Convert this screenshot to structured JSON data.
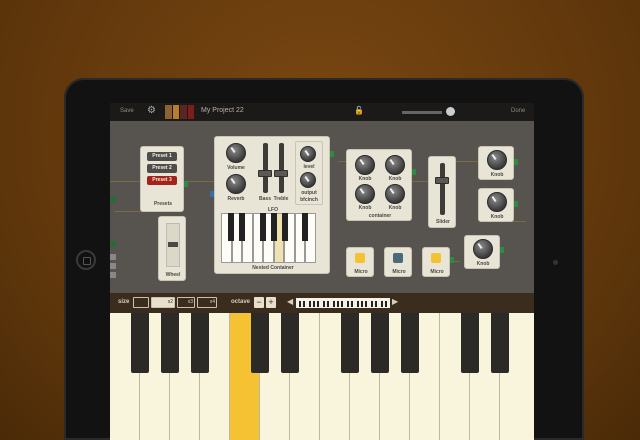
{
  "topbar": {
    "save_label": "Save",
    "project_name": "My Project 22",
    "done_label": "Done",
    "swatch_colors": [
      "#8a6330",
      "#b87d2d",
      "#5e2420",
      "#7d1e1a"
    ]
  },
  "modules": {
    "presets": {
      "title": "Presets",
      "items": [
        "Preset 1",
        "Preset 2",
        "Preset 3"
      ],
      "active_index": 2
    },
    "wheel": {
      "title": "Wheel"
    },
    "nested": {
      "title": "Nested Container",
      "lfo_label": "LFO",
      "volume_label": "Volume",
      "reverb_label": "Reverb",
      "bass_label": "Bass",
      "treble_label": "Treble",
      "level_label": "level",
      "output_label": "output",
      "bfcinch_label": "bfcinch"
    },
    "container": {
      "title": "container",
      "knob_label": "Knob"
    },
    "slider": {
      "title": "Slider"
    },
    "knob_single": {
      "label": "Knob"
    },
    "micro": {
      "label": "Micro",
      "pad_colors": [
        "#f4c232",
        "#4a6a7c",
        "#f4c232"
      ]
    }
  },
  "sizebar": {
    "size_label": "size",
    "size_options": [
      "",
      "x2",
      "x3",
      "x4"
    ],
    "selected_size_index": 1,
    "octave_label": "octave",
    "octave_minus": "−",
    "octave_plus": "+",
    "left_arrow": "◀",
    "right_arrow": "▶"
  },
  "keyboard": {
    "white_key_count": 14,
    "pressed_white_index": 4,
    "pressed_color": "#f4c232"
  }
}
